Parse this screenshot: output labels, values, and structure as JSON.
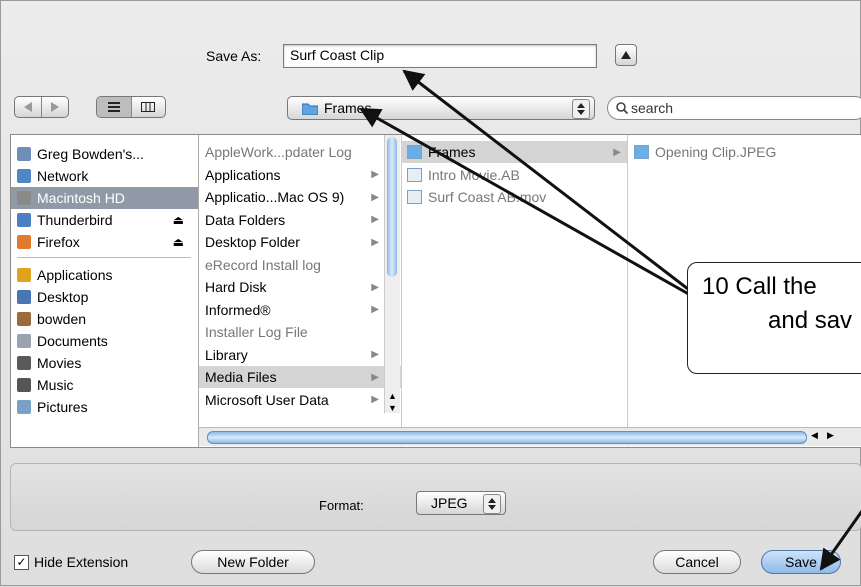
{
  "save_as": {
    "label": "Save As:",
    "value": "Surf Coast Clip"
  },
  "toolbar": {
    "back_icon": "chevron-left-icon",
    "forward_icon": "chevron-right-icon",
    "location": "Frames",
    "search_placeholder": "search"
  },
  "sidebar": {
    "items": [
      {
        "label": "Greg Bowden's...",
        "icon": "computer-icon",
        "color": "#6f8fb8"
      },
      {
        "label": "Network",
        "icon": "network-icon",
        "color": "#4f87c9"
      },
      {
        "label": "Macintosh HD",
        "icon": "hard-disk-icon",
        "color": "#8a8a8a",
        "selected": true
      },
      {
        "label": "Thunderbird",
        "icon": "thunderbird-icon",
        "color": "#4d7fc4",
        "eject": true
      },
      {
        "label": "Firefox",
        "icon": "firefox-icon",
        "color": "#e27a2e",
        "eject": true
      },
      {
        "label": "Applications",
        "icon": "applications-icon",
        "color": "#e0a31c"
      },
      {
        "label": "Desktop",
        "icon": "desktop-icon",
        "color": "#4a76b5"
      },
      {
        "label": "bowden",
        "icon": "home-icon",
        "color": "#9a6b3c"
      },
      {
        "label": "Documents",
        "icon": "documents-icon",
        "color": "#9aa3ad"
      },
      {
        "label": "Movies",
        "icon": "movies-icon",
        "color": "#5a5a5a"
      },
      {
        "label": "Music",
        "icon": "music-icon",
        "color": "#555555"
      },
      {
        "label": "Pictures",
        "icon": "pictures-icon",
        "color": "#7aa1c8"
      }
    ]
  },
  "column1": [
    {
      "label": "AppleWork...pdater Log",
      "gray": true
    },
    {
      "label": "Applications"
    },
    {
      "label": "Applicatio...Mac OS 9)"
    },
    {
      "label": "Data Folders"
    },
    {
      "label": "Desktop Folder"
    },
    {
      "label": "eRecord Install log",
      "gray": true
    },
    {
      "label": "Hard Disk"
    },
    {
      "label": "Informed®"
    },
    {
      "label": "Installer Log File",
      "gray": true
    },
    {
      "label": "Library"
    },
    {
      "label": "Media Files",
      "selected": true
    },
    {
      "label": "Microsoft User Data"
    }
  ],
  "column2": [
    {
      "label": "Frames",
      "selected": true
    },
    {
      "label": "Intro Movie.AB",
      "gray": true
    },
    {
      "label": "Surf Coast AB.mov",
      "gray": true
    }
  ],
  "column3": [
    {
      "label": "Opening Clip.JPEG",
      "gray": true
    }
  ],
  "format": {
    "label": "Format:",
    "value": "JPEG"
  },
  "bottom": {
    "hide_extension": "Hide Extension",
    "new_folder": "New Folder",
    "cancel": "Cancel",
    "save": "Save"
  },
  "callout": {
    "line1": "10  Call the",
    "line2": "and sav"
  }
}
